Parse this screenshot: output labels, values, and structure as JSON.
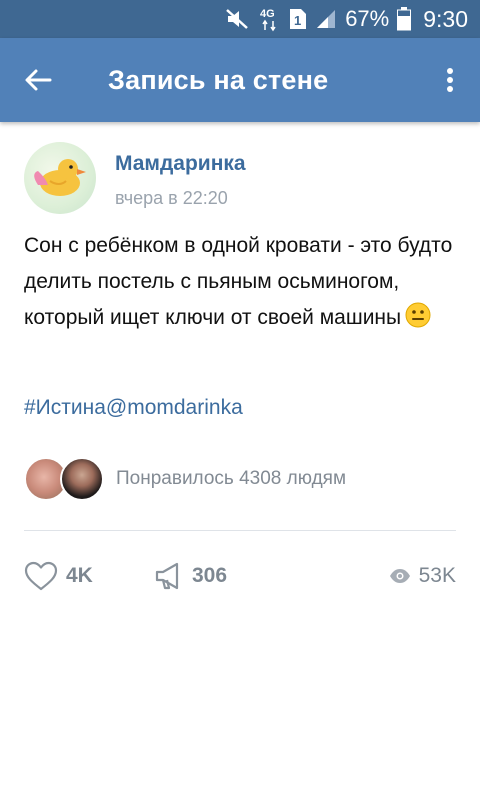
{
  "status_bar": {
    "network_label": "4G",
    "sim_slot": "1",
    "battery_percent": "67%",
    "time": "9:30"
  },
  "app_bar": {
    "title": "Запись на стене"
  },
  "post": {
    "author": "Мамдаринка",
    "date": "вчера в 22:20",
    "text": "Сон с ребёнком в одной кровати - это будто делить постель с пьяным осьминогом, который ищет ключи от своей машины",
    "emoji": "neutral-face",
    "hashtag": "#Истина@momdarinka",
    "likes_text": "Понравилось 4308 людям"
  },
  "actions": {
    "likes_count": "4K",
    "shares_count": "306",
    "views_count": "53K"
  },
  "colors": {
    "status_bar_bg": "#3f6892",
    "app_bar_bg": "#5181b8",
    "link": "#3c6c9e",
    "muted": "#7d8791"
  }
}
